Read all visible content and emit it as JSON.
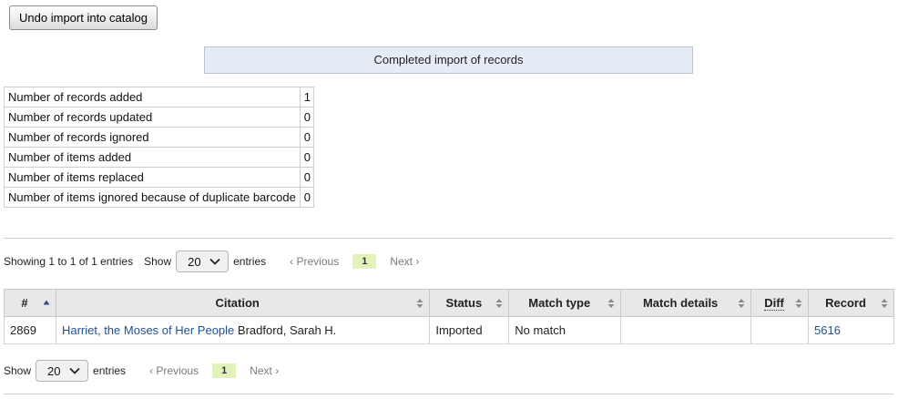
{
  "actions": {
    "undo_label": "Undo import into catalog"
  },
  "banner": {
    "text": "Completed import of records"
  },
  "summary": [
    {
      "label": "Number of records added",
      "value": "1"
    },
    {
      "label": "Number of records updated",
      "value": "0"
    },
    {
      "label": "Number of records ignored",
      "value": "0"
    },
    {
      "label": "Number of items added",
      "value": "0"
    },
    {
      "label": "Number of items replaced",
      "value": "0"
    },
    {
      "label": "Number of items ignored because of duplicate barcode",
      "value": "0"
    }
  ],
  "pager_top": {
    "info": "Showing 1 to 1 of 1 entries",
    "show_label": "Show",
    "page_size": "20",
    "entries_label": "entries",
    "prev": "Previous",
    "current": "1",
    "next": "Next"
  },
  "table": {
    "headers": {
      "number": "#",
      "citation": "Citation",
      "status": "Status",
      "match_type": "Match type",
      "match_details": "Match details",
      "diff": "Diff",
      "record": "Record"
    },
    "rows": [
      {
        "number": "2869",
        "citation_title": "Harriet, the Moses of Her People",
        "citation_author": "Bradford, Sarah H.",
        "status": "Imported",
        "match_type": "No match",
        "match_details": "",
        "diff": "",
        "record": "5616"
      }
    ]
  },
  "pager_bottom": {
    "show_label": "Show",
    "page_size": "20",
    "entries_label": "entries",
    "prev": "Previous",
    "current": "1",
    "next": "Next"
  },
  "colors": {
    "banner_bg": "#e6ecf5",
    "current_page_bg": "#e1f3b9",
    "link": "#1f4e9a",
    "header_bg": "#e8e8e8"
  }
}
